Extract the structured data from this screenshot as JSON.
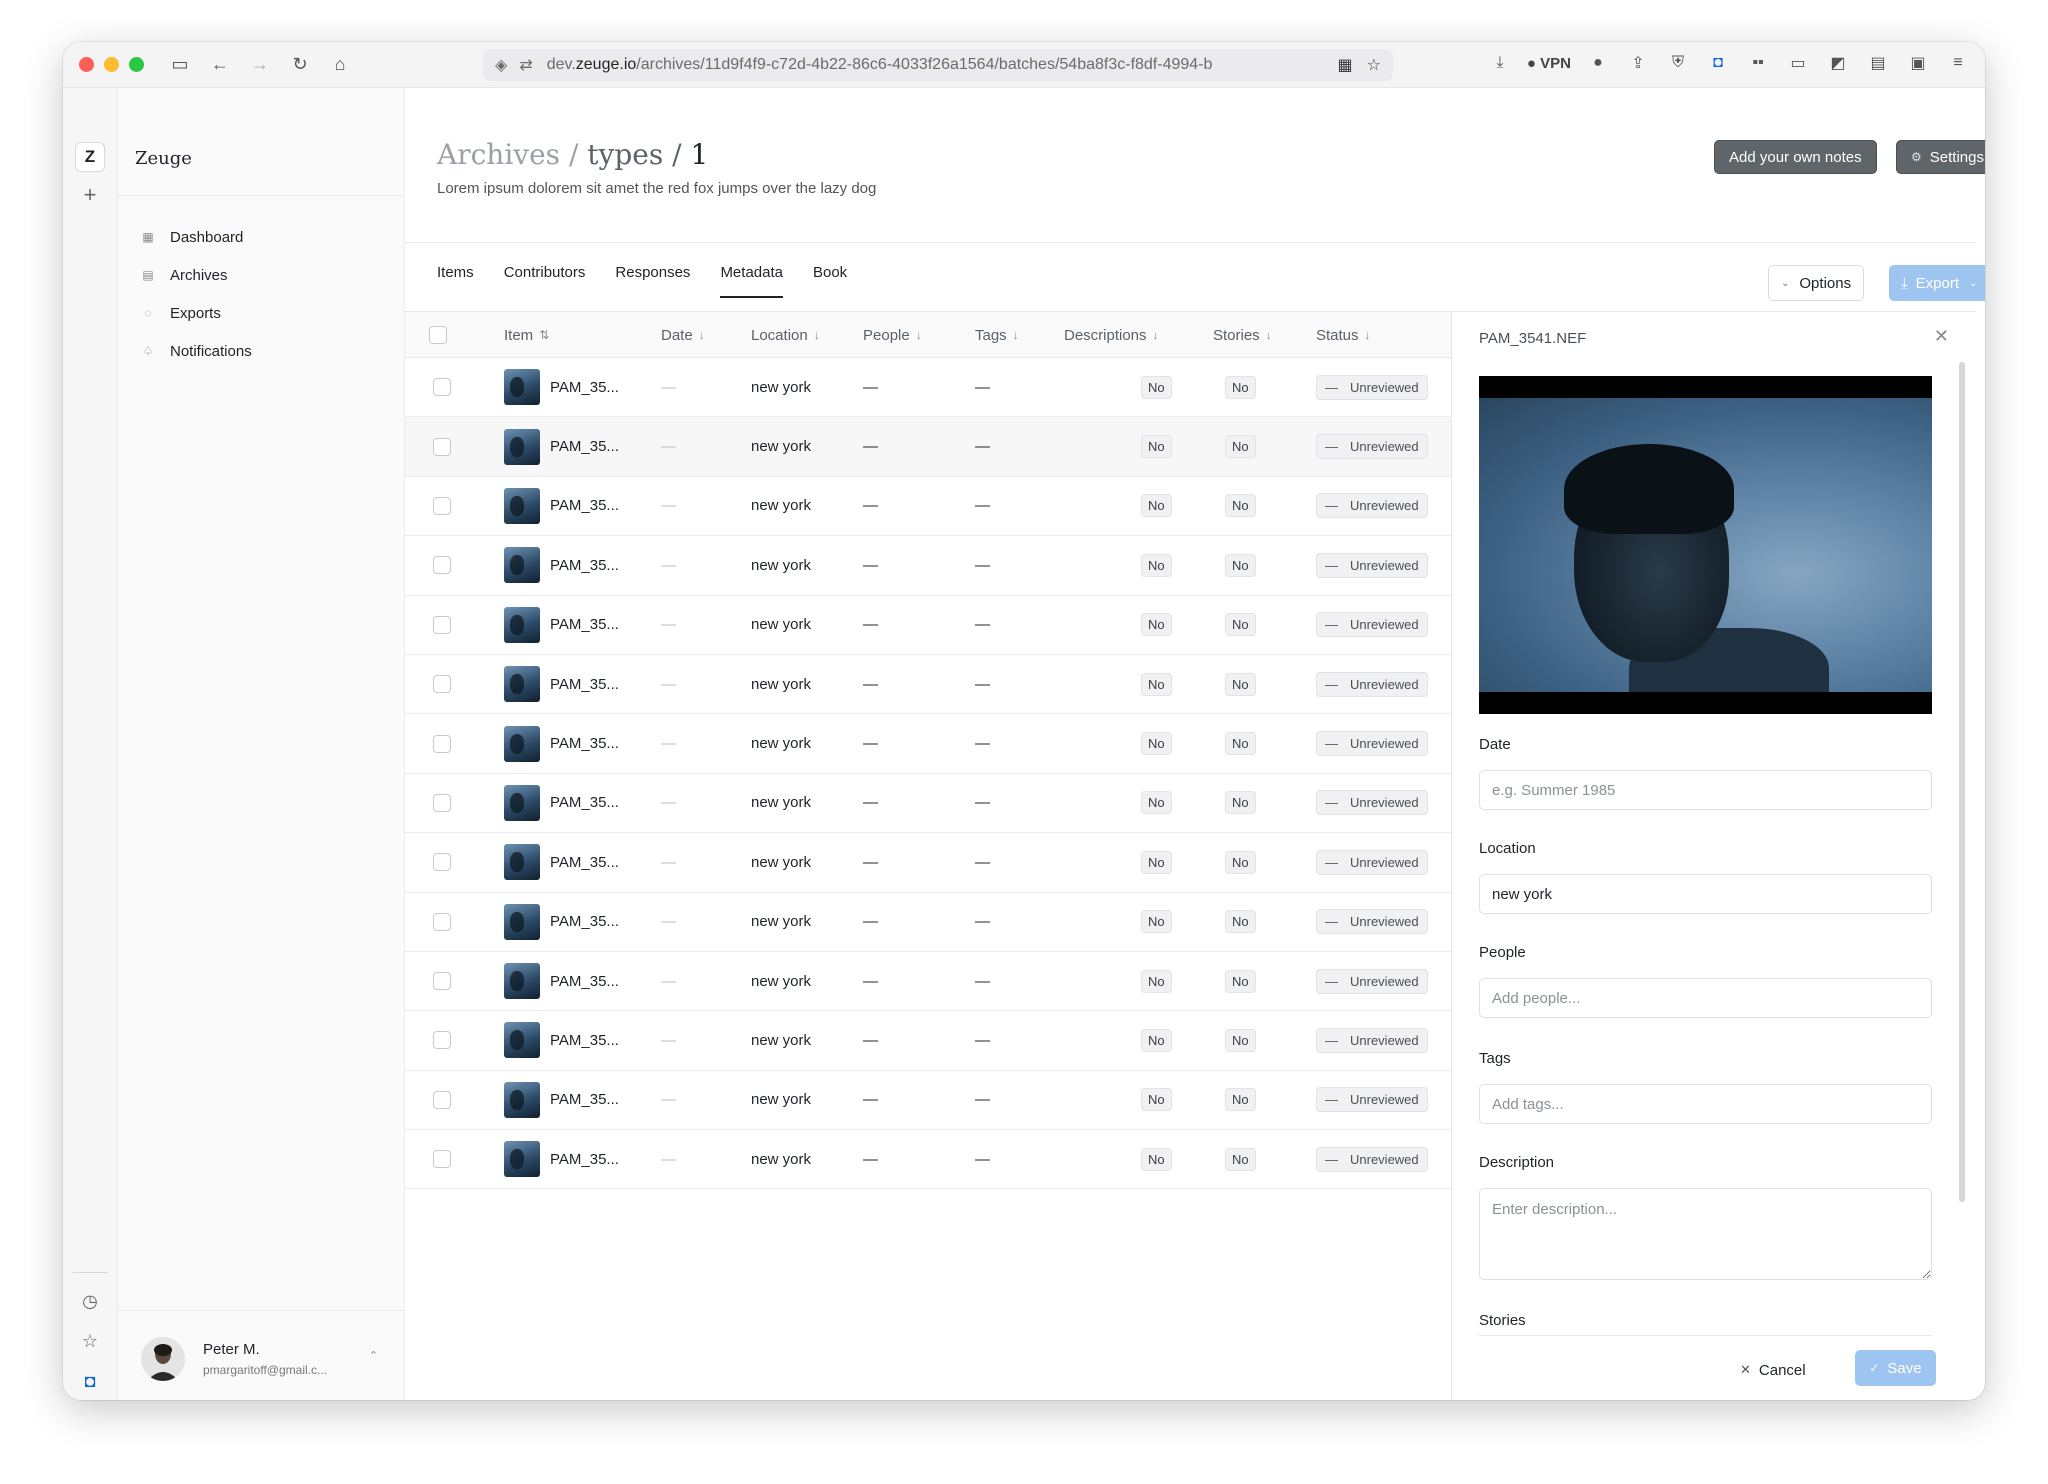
{
  "browser": {
    "url_prefix": "dev.",
    "url_domain": "zeuge.io",
    "url_path": "/archives/11d9f4f9-c72d-4b22-86c6-4033f26a1564/batches/54ba8f3c-f8df-4994-b",
    "vpn_label": "VPN"
  },
  "rail": {
    "logo": "Z"
  },
  "sidebar": {
    "brand": "Zeuge",
    "items": [
      {
        "label": "Dashboard",
        "icon": "grid-icon"
      },
      {
        "label": "Archives",
        "icon": "archive-icon"
      },
      {
        "label": "Exports",
        "icon": "export-icon"
      },
      {
        "label": "Notifications",
        "icon": "bell-icon"
      }
    ],
    "user": {
      "name": "Peter M.",
      "email": "pmargaritoff@gmail.c..."
    }
  },
  "header": {
    "breadcrumb_1": "Archives",
    "breadcrumb_sep": " / ",
    "breadcrumb_2": "types",
    "breadcrumb_3": "1",
    "subtitle": "Lorem ipsum dolorem sit amet the red fox jumps over the lazy dog",
    "notes_button": "Add your own notes",
    "settings_button": "Settings"
  },
  "tabs": [
    {
      "label": "Items"
    },
    {
      "label": "Contributors"
    },
    {
      "label": "Responses"
    },
    {
      "label": "Metadata",
      "active": true
    },
    {
      "label": "Book"
    }
  ],
  "toolbar": {
    "options_label": "Options",
    "export_label": "Export"
  },
  "table": {
    "columns": [
      "Item",
      "Date",
      "Location",
      "People",
      "Tags",
      "Descriptions",
      "Stories",
      "Status"
    ],
    "rows": [
      {
        "item": "PAM_35...",
        "date": "—",
        "location": "new york",
        "people": "—",
        "tags": "—",
        "descriptions": "No",
        "stories": "No",
        "status": "Unreviewed"
      },
      {
        "item": "PAM_35...",
        "date": "—",
        "location": "new york",
        "people": "—",
        "tags": "—",
        "descriptions": "No",
        "stories": "No",
        "status": "Unreviewed"
      },
      {
        "item": "PAM_35...",
        "date": "—",
        "location": "new york",
        "people": "—",
        "tags": "—",
        "descriptions": "No",
        "stories": "No",
        "status": "Unreviewed"
      },
      {
        "item": "PAM_35...",
        "date": "—",
        "location": "new york",
        "people": "—",
        "tags": "—",
        "descriptions": "No",
        "stories": "No",
        "status": "Unreviewed"
      },
      {
        "item": "PAM_35...",
        "date": "—",
        "location": "new york",
        "people": "—",
        "tags": "—",
        "descriptions": "No",
        "stories": "No",
        "status": "Unreviewed"
      },
      {
        "item": "PAM_35...",
        "date": "—",
        "location": "new york",
        "people": "—",
        "tags": "—",
        "descriptions": "No",
        "stories": "No",
        "status": "Unreviewed"
      },
      {
        "item": "PAM_35...",
        "date": "—",
        "location": "new york",
        "people": "—",
        "tags": "—",
        "descriptions": "No",
        "stories": "No",
        "status": "Unreviewed"
      },
      {
        "item": "PAM_35...",
        "date": "—",
        "location": "new york",
        "people": "—",
        "tags": "—",
        "descriptions": "No",
        "stories": "No",
        "status": "Unreviewed"
      },
      {
        "item": "PAM_35...",
        "date": "—",
        "location": "new york",
        "people": "—",
        "tags": "—",
        "descriptions": "No",
        "stories": "No",
        "status": "Unreviewed"
      },
      {
        "item": "PAM_35...",
        "date": "—",
        "location": "new york",
        "people": "—",
        "tags": "—",
        "descriptions": "No",
        "stories": "No",
        "status": "Unreviewed"
      },
      {
        "item": "PAM_35...",
        "date": "—",
        "location": "new york",
        "people": "—",
        "tags": "—",
        "descriptions": "No",
        "stories": "No",
        "status": "Unreviewed"
      },
      {
        "item": "PAM_35...",
        "date": "—",
        "location": "new york",
        "people": "—",
        "tags": "—",
        "descriptions": "No",
        "stories": "No",
        "status": "Unreviewed"
      },
      {
        "item": "PAM_35...",
        "date": "—",
        "location": "new york",
        "people": "—",
        "tags": "—",
        "descriptions": "No",
        "stories": "No",
        "status": "Unreviewed"
      },
      {
        "item": "PAM_35...",
        "date": "—",
        "location": "new york",
        "people": "—",
        "tags": "—",
        "descriptions": "No",
        "stories": "No",
        "status": "Unreviewed"
      }
    ]
  },
  "panel": {
    "title": "PAM_3541.NEF",
    "date_label": "Date",
    "date_placeholder": "e.g. Summer 1985",
    "location_label": "Location",
    "location_value": "new york",
    "people_label": "People",
    "people_placeholder": "Add people...",
    "tags_label": "Tags",
    "tags_placeholder": "Add tags...",
    "description_label": "Description",
    "description_placeholder": "Enter description...",
    "stories_label": "Stories",
    "cancel_label": "Cancel",
    "save_label": "Save"
  }
}
